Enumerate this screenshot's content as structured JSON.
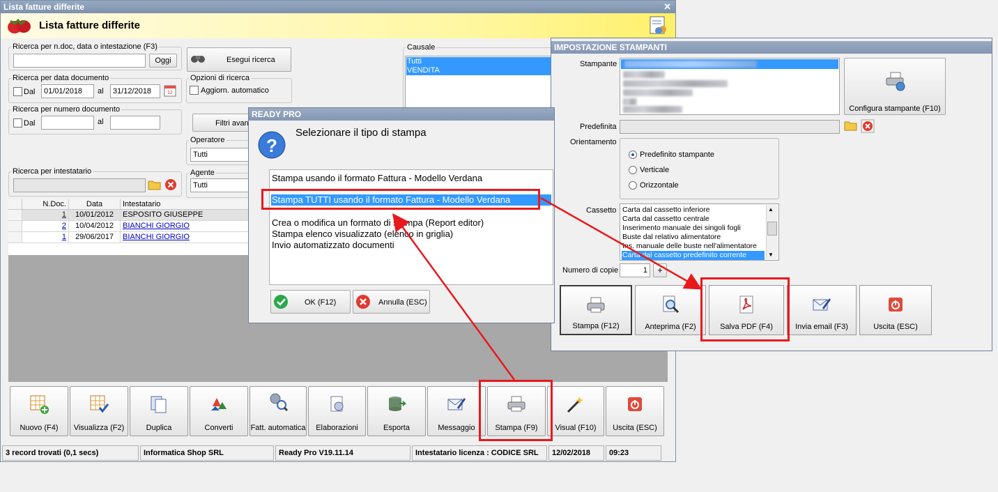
{
  "main": {
    "title": "Lista fatture differite",
    "header_title": "Lista fatture differite",
    "search_text": {
      "legend": "Ricerca per n.doc, data o intestazione (F3)",
      "value": "",
      "today_button": "Oggi"
    },
    "search_button": "Esegui ricerca",
    "by_date": {
      "legend": "Ricerca per data documento",
      "from_label": "Dal",
      "from": "01/01/2018",
      "to_label": "al",
      "to": "31/12/2018"
    },
    "search_options": {
      "legend": "Opzioni di ricerca",
      "auto_update": "Aggiorn. automatico"
    },
    "by_number": {
      "legend": "Ricerca per numero documento",
      "from_label": "Dal",
      "to_label": "al"
    },
    "advanced_filter": "Filtri avan",
    "operator": {
      "legend": "Operatore",
      "value": "Tutti"
    },
    "by_holder": {
      "legend": "Ricerca per intestatario"
    },
    "agent": {
      "legend": "Agente",
      "value": "Tutti"
    },
    "causale": {
      "legend": "Causale",
      "items": [
        "Tutti",
        "VENDITA"
      ]
    },
    "grid": {
      "columns": [
        "N.Doc.",
        "Data",
        "Intestatario"
      ],
      "rows": [
        [
          "1",
          "10/01/2012",
          "ESPOSITO GIUSEPPE"
        ],
        [
          "2",
          "10/04/2012",
          "BIANCHI GIORGIO"
        ],
        [
          "1",
          "29/06/2017",
          "BIANCHI GIORGIO"
        ]
      ]
    },
    "toolbar": [
      "Nuovo (F4)",
      "Visualizza (F2)",
      "Duplica",
      "Converti",
      "Fatt. automatica",
      "Elaborazioni",
      "Esporta",
      "Messaggio",
      "Stampa (F9)",
      "Visual (F10)",
      "Uscita (ESC)"
    ],
    "status": [
      "3 record trovati (0,1 secs)",
      "Informatica Shop SRL",
      "Ready Pro V19.11.14",
      "Intestatario licenza : CODICE SRL",
      "12/02/2018",
      "09:23"
    ]
  },
  "ready_dialog": {
    "title": "READY PRO",
    "question": "Selezionare il tipo di stampa",
    "options": [
      "Stampa usando il formato Fattura - Modello Verdana",
      "Stampa TUTTI usando il formato Fattura - Modello Verdana",
      "Crea o modifica un formato di stampa (Report editor)",
      "Stampa elenco visualizzato (elenco in griglia)",
      "Invio automatizzato documenti"
    ],
    "ok": "OK (F12)",
    "cancel": "Annulla (ESC)"
  },
  "printer_dialog": {
    "title": "IMPOSTAZIONE STAMPANTI",
    "printer_label": "Stampante",
    "configure": "Configura stampante (F10)",
    "default_label": "Predefinita",
    "orientation_label": "Orientamento",
    "orientation_options": [
      "Predefinito stampante",
      "Verticale",
      "Orizzontale"
    ],
    "tray_label": "Cassetto",
    "trays": [
      "Carta dal cassetto inferiore",
      "Carta dal cassetto centrale",
      "Inserimento manuale dei singoli fogli",
      "Buste dal relativo alimentatore",
      "Ins. manuale delle buste nell'alimentatore",
      "Carta dal cassetto predefinito corrente"
    ],
    "copies_label": "Numero di copie",
    "copies": "1",
    "plus": "+",
    "buttons": [
      "Stampa (F12)",
      "Anteprima (F2)",
      "Salva PDF (F4)",
      "Invia email (F3)",
      "Uscita (ESC)"
    ]
  },
  "colors": {
    "highlight": "#e8191d",
    "selection": "#3399ff"
  }
}
